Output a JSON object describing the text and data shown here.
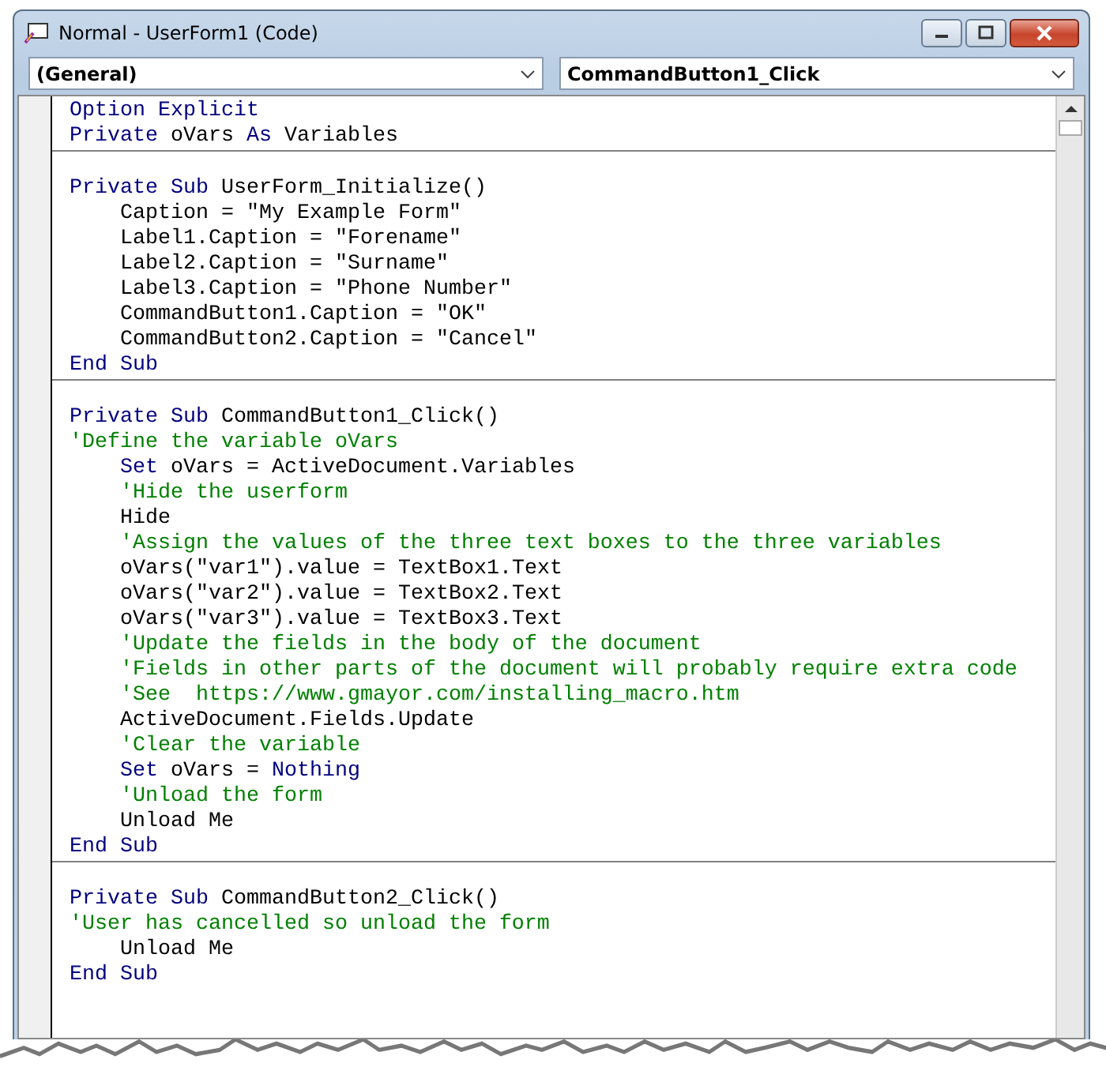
{
  "window": {
    "title": "Normal - UserForm1 (Code)"
  },
  "object_dropdown": {
    "value": "(General)"
  },
  "procedure_dropdown": {
    "value": "CommandButton1_Click"
  },
  "procedures": [
    {
      "lines": [
        {
          "indented": false,
          "tokens": [
            {
              "kind": "keyword",
              "text": "Option Explicit"
            }
          ]
        },
        {
          "indented": false,
          "tokens": [
            {
              "kind": "keyword",
              "text": "Private"
            },
            {
              "kind": "plain",
              "text": " oVars "
            },
            {
              "kind": "keyword",
              "text": "As"
            },
            {
              "kind": "plain",
              "text": " Variables"
            }
          ]
        }
      ]
    },
    {
      "lines": [
        {
          "indented": false,
          "tokens": [
            {
              "kind": "keyword",
              "text": "Private Sub"
            },
            {
              "kind": "plain",
              "text": " UserForm_Initialize()"
            }
          ]
        },
        {
          "indented": true,
          "tokens": [
            {
              "kind": "plain",
              "text": "Caption = \"My Example Form\""
            }
          ]
        },
        {
          "indented": true,
          "tokens": [
            {
              "kind": "plain",
              "text": "Label1.Caption = \"Forename\""
            }
          ]
        },
        {
          "indented": true,
          "tokens": [
            {
              "kind": "plain",
              "text": "Label2.Caption = \"Surname\""
            }
          ]
        },
        {
          "indented": true,
          "tokens": [
            {
              "kind": "plain",
              "text": "Label3.Caption = \"Phone Number\""
            }
          ]
        },
        {
          "indented": true,
          "tokens": [
            {
              "kind": "plain",
              "text": "CommandButton1.Caption = \"OK\""
            }
          ]
        },
        {
          "indented": true,
          "tokens": [
            {
              "kind": "plain",
              "text": "CommandButton2.Caption = \"Cancel\""
            }
          ]
        },
        {
          "indented": false,
          "tokens": [
            {
              "kind": "keyword",
              "text": "End Sub"
            }
          ]
        }
      ]
    },
    {
      "lines": [
        {
          "indented": false,
          "tokens": [
            {
              "kind": "keyword",
              "text": "Private Sub"
            },
            {
              "kind": "plain",
              "text": " CommandButton1_Click()"
            }
          ]
        },
        {
          "indented": false,
          "tokens": [
            {
              "kind": "comment",
              "text": "'Define the variable oVars"
            }
          ]
        },
        {
          "indented": true,
          "tokens": [
            {
              "kind": "keyword",
              "text": "Set"
            },
            {
              "kind": "plain",
              "text": " oVars = ActiveDocument.Variables"
            }
          ]
        },
        {
          "indented": true,
          "tokens": [
            {
              "kind": "comment",
              "text": "'Hide the userform"
            }
          ]
        },
        {
          "indented": true,
          "tokens": [
            {
              "kind": "plain",
              "text": "Hide"
            }
          ]
        },
        {
          "indented": true,
          "tokens": [
            {
              "kind": "comment",
              "text": "'Assign the values of the three text boxes to the three variables"
            }
          ]
        },
        {
          "indented": true,
          "tokens": [
            {
              "kind": "plain",
              "text": "oVars(\"var1\").value = TextBox1.Text"
            }
          ]
        },
        {
          "indented": true,
          "tokens": [
            {
              "kind": "plain",
              "text": "oVars(\"var2\").value = TextBox2.Text"
            }
          ]
        },
        {
          "indented": true,
          "tokens": [
            {
              "kind": "plain",
              "text": "oVars(\"var3\").value = TextBox3.Text"
            }
          ]
        },
        {
          "indented": true,
          "tokens": [
            {
              "kind": "comment",
              "text": "'Update the fields in the body of the document"
            }
          ]
        },
        {
          "indented": true,
          "tokens": [
            {
              "kind": "comment",
              "text": "'Fields in other parts of the document will probably require extra code"
            }
          ]
        },
        {
          "indented": true,
          "tokens": [
            {
              "kind": "comment",
              "text": "'See  https://www.gmayor.com/installing_macro.htm"
            }
          ]
        },
        {
          "indented": true,
          "tokens": [
            {
              "kind": "plain",
              "text": "ActiveDocument.Fields.Update"
            }
          ]
        },
        {
          "indented": true,
          "tokens": [
            {
              "kind": "comment",
              "text": "'Clear the variable"
            }
          ]
        },
        {
          "indented": true,
          "tokens": [
            {
              "kind": "keyword",
              "text": "Set"
            },
            {
              "kind": "plain",
              "text": " oVars = "
            },
            {
              "kind": "keyword",
              "text": "Nothing"
            }
          ]
        },
        {
          "indented": true,
          "tokens": [
            {
              "kind": "comment",
              "text": "'Unload the form"
            }
          ]
        },
        {
          "indented": true,
          "tokens": [
            {
              "kind": "plain",
              "text": "Unload Me"
            }
          ]
        },
        {
          "indented": false,
          "tokens": [
            {
              "kind": "keyword",
              "text": "End Sub"
            }
          ]
        }
      ]
    },
    {
      "lines": [
        {
          "indented": false,
          "tokens": [
            {
              "kind": "keyword",
              "text": "Private Sub"
            },
            {
              "kind": "plain",
              "text": " CommandButton2_Click()"
            }
          ]
        },
        {
          "indented": false,
          "tokens": [
            {
              "kind": "comment",
              "text": "'User has cancelled so unload the form"
            }
          ]
        },
        {
          "indented": true,
          "tokens": [
            {
              "kind": "plain",
              "text": "Unload Me"
            }
          ]
        },
        {
          "indented": false,
          "tokens": [
            {
              "kind": "keyword",
              "text": "End Sub"
            }
          ]
        }
      ]
    }
  ]
}
